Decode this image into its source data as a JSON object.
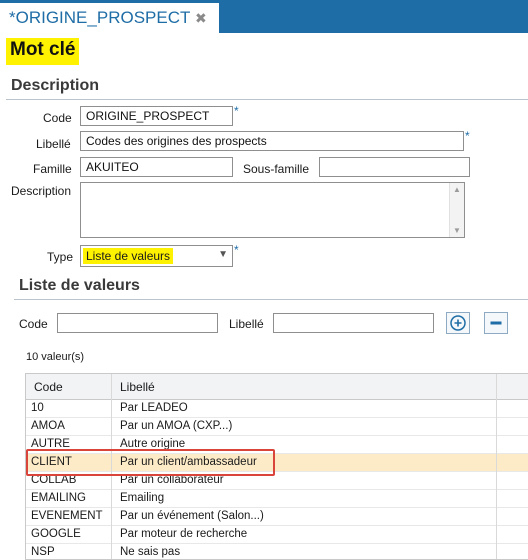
{
  "tab": {
    "title": "*ORIGINE_PROSPECT",
    "close": "✖"
  },
  "page_title": "Mot clé",
  "description_section": {
    "title": "Description",
    "code_label": "Code",
    "code_value": "ORIGINE_PROSPECT",
    "libelle_label": "Libellé",
    "libelle_value": "Codes des origines des prospects",
    "famille_label": "Famille",
    "famille_value": "AKUITEO",
    "sous_famille_label": "Sous-famille",
    "sous_famille_value": "",
    "description_label": "Description",
    "description_value": "",
    "type_label": "Type",
    "type_value": "Liste de valeurs",
    "required_mark": "*"
  },
  "values_section": {
    "title": "Liste de valeurs",
    "code_label": "Code",
    "code_value": "",
    "libelle_label": "Libellé",
    "libelle_value": "",
    "count_text": "10 valeur(s)",
    "columns": [
      "Code",
      "Libellé"
    ],
    "rows": [
      {
        "code": "10",
        "libelle": "Par LEADEO"
      },
      {
        "code": "AMOA",
        "libelle": "Par un AMOA (CXP...)"
      },
      {
        "code": "AUTRE",
        "libelle": "Autre origine"
      },
      {
        "code": "CLIENT",
        "libelle": "Par un client/ambassadeur",
        "selected": true
      },
      {
        "code": "COLLAB",
        "libelle": "Par un collaborateur"
      },
      {
        "code": "EMAILING",
        "libelle": "Emailing"
      },
      {
        "code": "EVENEMENT",
        "libelle": "Par un événement (Salon...)"
      },
      {
        "code": "GOOGLE",
        "libelle": "Par moteur de recherche"
      },
      {
        "code": "NSP",
        "libelle": "Ne sais pas"
      }
    ]
  },
  "icons": {
    "tab_close": "close-icon",
    "add": "add-circle-icon",
    "remove": "minus-icon",
    "dropdown": "chevron-down-icon"
  },
  "colors": {
    "accent": "#1f6da6",
    "highlight_yellow": "#fff200",
    "selected_row": "#fdebc8",
    "callout_red": "#d9443b"
  }
}
